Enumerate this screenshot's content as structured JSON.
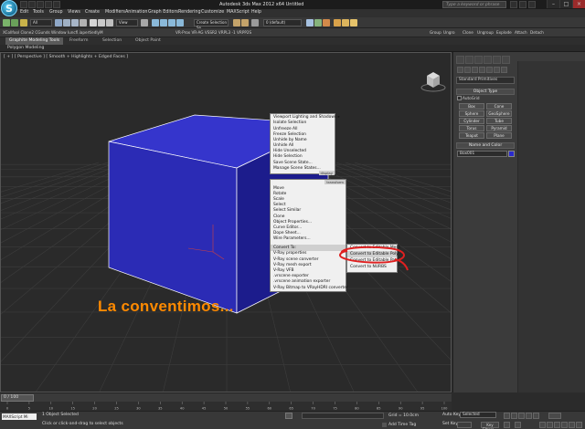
{
  "window": {
    "title": "Autodesk 3ds Max 2012 x64      Untitled",
    "search_placeholder": "Type a keyword or phrase",
    "logo_letter": "S"
  },
  "menubar": [
    "Edit",
    "Tools",
    "Group",
    "Views",
    "Create",
    "Modifiers",
    "Animation",
    "Graph Editors",
    "Rendering",
    "Customize",
    "MAXScript",
    "Help"
  ],
  "toolbar": {
    "filter_dropdown": "All",
    "view_dropdown": "View",
    "selection_set": "Create Selection Se",
    "layer_dropdown": "0 (default)"
  },
  "toolbar2": {
    "left_text": "XCollfool  Clone2  CGunds  Window  Iuncfl.iapertiedlyM",
    "mid_text": "VR-Prox  VR-AG  VSSR2  VRPL3 -1  VRPP2S",
    "right_items": [
      "Group",
      "Ungro",
      "Clone",
      "Ungroup",
      "Explode",
      "Attach",
      "Detach"
    ]
  },
  "ribbon": {
    "tabs": [
      "Graphite Modeling Tools",
      "Freeform",
      "Selection",
      "Object Paint"
    ],
    "sub_label": "Polygon Modeling"
  },
  "viewport": {
    "label": "[ + ] [ Perspective ] [ Smooth + Highlights + Edged Faces ]",
    "overlay_text": "La conventimos..."
  },
  "quad_menu": {
    "top_right_items": [
      "Viewport Lighting and Shadows ▸",
      "Isolate Selection",
      "Unfreeze All",
      "Freeze Selection",
      "Unhide by Name",
      "Unhide All",
      "Hide Unselected",
      "Hide Selection",
      "Save Scene State...",
      "Manage Scene States..."
    ],
    "display_label": "display",
    "transform_label": "transform",
    "bottom_right_items": [
      "Move",
      "Rotate",
      "Scale",
      "Select",
      "Select Similar",
      "Clone",
      "Object Properties...",
      "Curve Editor...",
      "Dope Sheet...",
      "Wire Parameters...",
      "Convert To:",
      "V-Ray properties",
      "V-Ray scene converter",
      "V-Ray mesh export",
      "V-Ray VFB",
      ".vrscene exporter",
      ".vrscene animation exporter",
      "V-Ray Bitmap to VRayHDRI converter"
    ],
    "submenu_items": [
      "Convert to Editable Mesh",
      "Convert to Editable Poly",
      "Convert to Editable Patch",
      "Convert to NURBS"
    ],
    "highlight_color": "#e02020"
  },
  "command_panel": {
    "dropdown": "Standard Primitives",
    "object_type_title": "Object Type",
    "autogrid_label": "AutoGrid",
    "object_buttons": [
      "Box",
      "Cone",
      "Sphere",
      "GeoSphere",
      "Cylinder",
      "Tube",
      "Torus",
      "Pyramid",
      "Teapot",
      "Plane"
    ],
    "name_color_title": "Name and Color",
    "object_name": "Box001",
    "object_color": "#2a2acc"
  },
  "timeline": {
    "slider_label": "0 / 100",
    "ticks": [
      "0",
      "5",
      "10",
      "15",
      "20",
      "25",
      "30",
      "35",
      "40",
      "45",
      "50",
      "55",
      "60",
      "65",
      "70",
      "75",
      "80",
      "85",
      "90",
      "95",
      "100"
    ]
  },
  "statusbar": {
    "maxscript_label": "MAXScript Mi",
    "status_line1": "1 Object Selected",
    "status_line2": "Click or click-and-drag to select objects",
    "grid_text": "Grid = 10.0cm",
    "add_time_tag": "Add Time Tag",
    "auto_key": "Auto Key",
    "set_key": "Set Key",
    "selected_dropdown": "Selected",
    "key_filters": "Key Filters..."
  },
  "colors": {
    "box_front": "#2b2bb5",
    "box_side": "#1c1c8c",
    "box_top": "#3535cc",
    "orange_text": "#ff8a00"
  }
}
